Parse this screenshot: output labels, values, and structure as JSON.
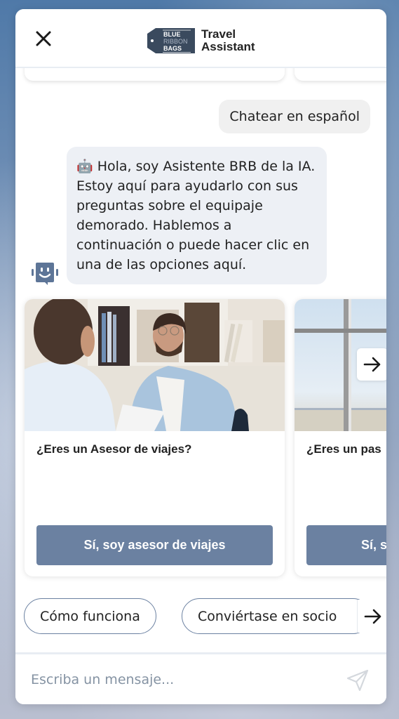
{
  "header": {
    "close_icon": "close-icon",
    "logo": {
      "line1": "BLUE",
      "line2": "RIBBON",
      "line3": "BAGS"
    },
    "title_line1": "Travel",
    "title_line2": "Assistant"
  },
  "messages": {
    "user": "Chatear en español",
    "bot_emoji": "🤖",
    "bot": "Hola, soy Asistente BRB de la IA. Estoy aquí para ayudarlo con sus preguntas sobre el equipaje demorado. Hablemos a continuación o puede hacer clic en una de las opciones aquí."
  },
  "carousel": {
    "cards": [
      {
        "image": "office meeting photo",
        "title": "¿Eres un Asesor de viajes?",
        "button": "Sí, soy asesor de viajes"
      },
      {
        "image": "airport window photo",
        "title": "¿Eres un pas",
        "button": "Sí, s"
      }
    ],
    "next_icon": "arrow-right-icon"
  },
  "quick_replies": [
    {
      "label": "Cómo funciona"
    },
    {
      "label": "Conviértase en socio"
    }
  ],
  "composer": {
    "placeholder": "Escriba un mensaje...",
    "value": ""
  },
  "colors": {
    "accent": "#6b81a1",
    "bot_bubble": "#edf0f5",
    "user_bubble": "#f0f0f0",
    "brand_dark": "#3a4a5e"
  }
}
